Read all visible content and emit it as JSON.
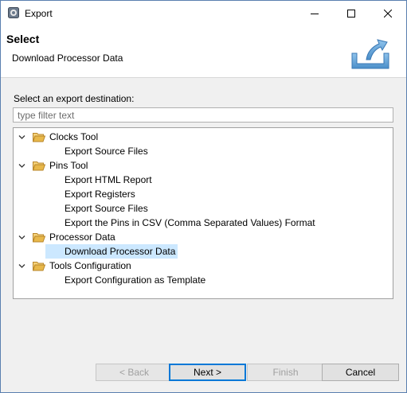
{
  "window": {
    "title": "Export"
  },
  "header": {
    "title": "Select",
    "description": "Download Processor Data"
  },
  "content": {
    "destination_label": "Select an export destination:",
    "filter_placeholder": "type filter text",
    "filter_value": ""
  },
  "tree": {
    "categories": [
      {
        "label": "Clocks Tool",
        "children": [
          "Export Source Files"
        ]
      },
      {
        "label": "Pins Tool",
        "children": [
          "Export HTML Report",
          "Export Registers",
          "Export Source Files",
          "Export the Pins in CSV (Comma Separated Values) Format"
        ]
      },
      {
        "label": "Processor Data",
        "children": [
          "Download Processor Data"
        ]
      },
      {
        "label": "Tools Configuration",
        "children": [
          "Export Configuration as Template"
        ]
      }
    ],
    "selected": "Download Processor Data"
  },
  "buttons": {
    "back": "< Back",
    "next": "Next >",
    "finish": "Finish",
    "cancel": "Cancel"
  },
  "colors": {
    "selection": "#cce8ff",
    "folder": "#e8b84a",
    "accent": "#0078d7"
  }
}
